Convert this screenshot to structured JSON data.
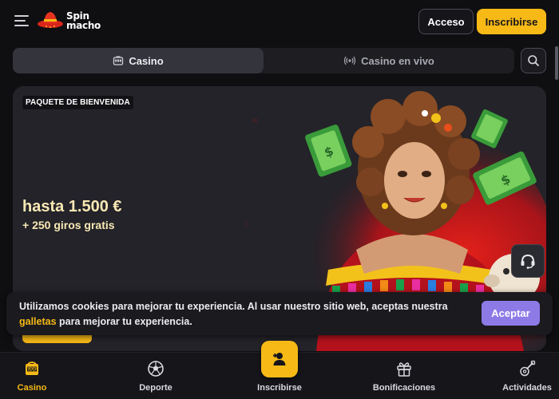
{
  "header": {
    "logo_line1": "Spin",
    "logo_line2": "macho",
    "login_label": "Acceso",
    "register_label": "Inscribirse"
  },
  "tabs": [
    {
      "label": "Casino",
      "icon": "slot-machine-icon",
      "active": true
    },
    {
      "label": "Casino en vivo",
      "icon": "live-broadcast-icon",
      "active": false
    }
  ],
  "banner": {
    "badge": "PAQUETE DE BIENVENIDA",
    "amount": "hasta 1.500 €",
    "spins": "+ 250 giros gratis"
  },
  "cookie": {
    "text_before": "Utilizamos cookies para mejorar tu experiencia. Al usar nuestro sitio web, aceptas nuestra",
    "link": "galletas",
    "text_after": "para mejorar tu experiencia.",
    "accept_label": "Aceptar"
  },
  "bottom_nav": [
    {
      "label": "Casino",
      "icon": "slot-machine-icon",
      "active": true
    },
    {
      "label": "Deporte",
      "icon": "soccer-ball-icon",
      "active": false
    },
    {
      "label": "Inscribirse",
      "icon": "user-plus-icon",
      "active": false
    },
    {
      "label": "Bonificaciones",
      "icon": "gift-icon",
      "active": false
    },
    {
      "label": "Actividades",
      "icon": "guitar-icon",
      "active": false
    }
  ],
  "colors": {
    "accent": "#f7b916",
    "accept": "#8e7ae6",
    "background": "#0f0f12"
  }
}
